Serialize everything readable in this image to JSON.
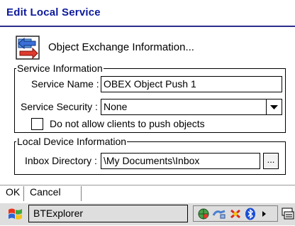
{
  "dialog": {
    "title": "Edit Local Service",
    "header_text": "Object Exchange Information..."
  },
  "service_info": {
    "group_label": "Service Information",
    "name_label": "Service Name :",
    "name_value": "OBEX Object Push 1",
    "security_label": "Service Security :",
    "security_value": "None",
    "no_push_label": "Do not allow clients to push objects",
    "no_push_checked": false
  },
  "local_device": {
    "group_label": "Local Device Information",
    "inbox_label": "Inbox Directory :",
    "inbox_value": "\\My Documents\\Inbox",
    "browse_label": "..."
  },
  "menubar": {
    "ok_label": "OK",
    "cancel_label": "Cancel"
  },
  "taskbar": {
    "app_label": "BTExplorer",
    "tray_icons": [
      "network-globe-icon",
      "connection-icon",
      "sync-icon",
      "bluetooth-icon"
    ],
    "start_icon": "windows-flag-icon",
    "keyboard_icon": "input-panel-icon"
  },
  "colors": {
    "title_text": "#0d1a9c",
    "bluetooth": "#1a4fd6",
    "taskbar_bg": "#dedede"
  }
}
